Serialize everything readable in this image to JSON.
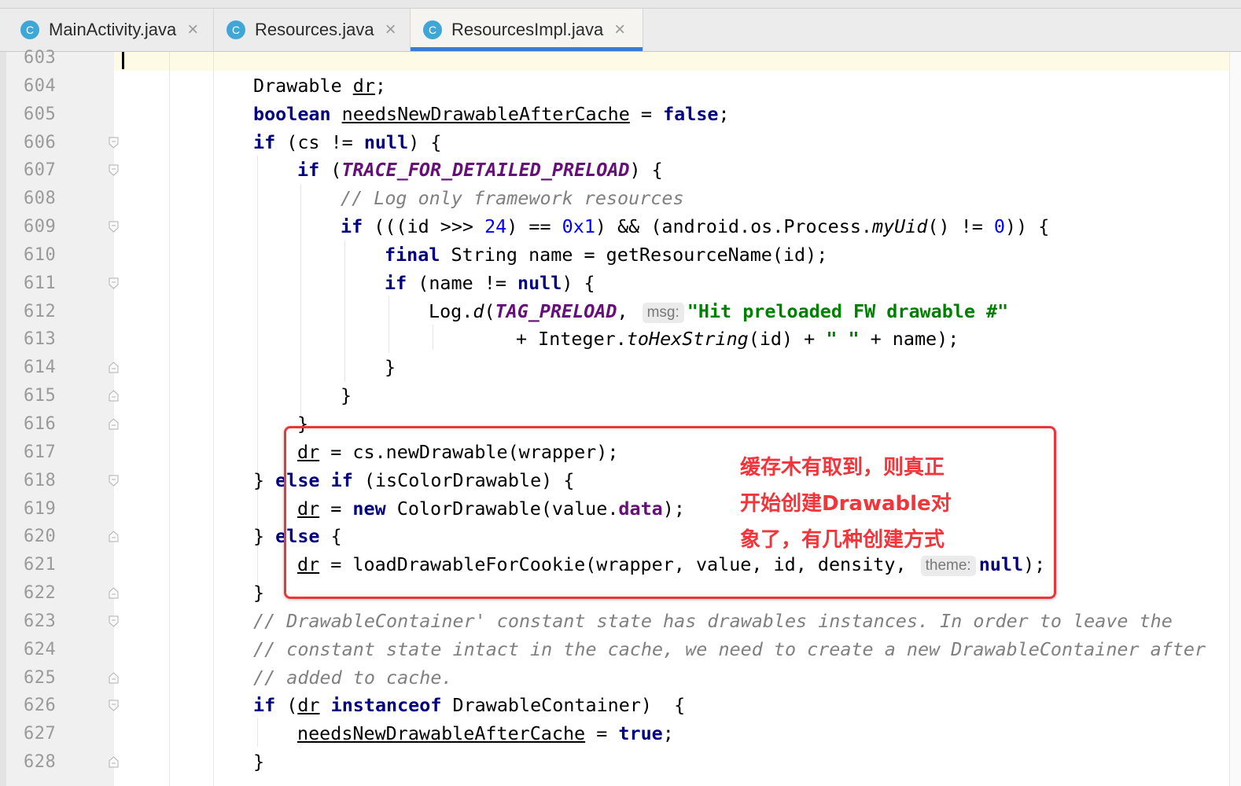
{
  "tabs": [
    {
      "label": "MainActivity.java",
      "icon": "C",
      "active": false
    },
    {
      "label": "Resources.java",
      "icon": "C",
      "active": false
    },
    {
      "label": "ResourcesImpl.java",
      "icon": "C",
      "active": true
    }
  ],
  "line_numbers": [
    "603",
    "604",
    "605",
    "606",
    "607",
    "608",
    "609",
    "610",
    "611",
    "612",
    "613",
    "614",
    "615",
    "616",
    "617",
    "618",
    "619",
    "620",
    "621",
    "622",
    "623",
    "624",
    "625",
    "626",
    "627",
    "628"
  ],
  "code": {
    "l604_type": "Drawable ",
    "l604_var": "dr",
    "l604_end": ";",
    "l605_kw": "boolean",
    "l605_var": "needsNewDrawableAfterCache",
    "l605_op": " = ",
    "l605_val": "false",
    "l605_end": ";",
    "l606_kw": "if",
    "l606_mid": " (cs != ",
    "l606_null": "null",
    "l606_end": ") {",
    "l607_kw": "if",
    "l607_open": " (",
    "l607_field": "TRACE_FOR_DETAILED_PRELOAD",
    "l607_end": ") {",
    "l608_comment": "// Log only framework resources",
    "l609_kw": "if",
    "l609_a": " (((id >>> ",
    "l609_n1": "24",
    "l609_b": ") == ",
    "l609_n2": "0x1",
    "l609_c": ") && (android.os.Process.",
    "l609_m": "myUid",
    "l609_d": "() != ",
    "l609_n3": "0",
    "l609_e": ")) {",
    "l610_kw": "final",
    "l610_rest": " String name = getResourceName(id);",
    "l611_kw": "if",
    "l611_mid": " (name != ",
    "l611_null": "null",
    "l611_end": ") {",
    "l612_a": "Log.",
    "l612_m": "d",
    "l612_b": "(",
    "l612_field": "TAG_PRELOAD",
    "l612_c": ", ",
    "l612_hint": "msg:",
    "l612_str": "\"Hit preloaded FW drawable #\"",
    "l613_a": "+ Integer.",
    "l613_m": "toHexString",
    "l613_b": "(id) + ",
    "l613_str": "\" \"",
    "l613_c": " + name);",
    "l614": "}",
    "l615": "}",
    "l616": "}",
    "l617_var": "dr",
    "l617_rest": " = cs.newDrawable(wrapper);",
    "l618_a": "} ",
    "l618_kw1": "else",
    "l618_sp": " ",
    "l618_kw2": "if",
    "l618_rest": " (isColorDrawable) {",
    "l619_var": "dr",
    "l619_a": " = ",
    "l619_kw": "new",
    "l619_b": " ColorDrawable(value.",
    "l619_field": "data",
    "l619_c": ");",
    "l620_a": "} ",
    "l620_kw": "else",
    "l620_b": " {",
    "l621_var": "dr",
    "l621_rest": " = loadDrawableForCookie(wrapper, value, id, density, ",
    "l621_hint": "theme:",
    "l621_null": "null",
    "l621_end": ");",
    "l622": "}",
    "l623_comment": "// DrawableContainer' constant state has drawables instances. In order to leave the",
    "l624_comment": "// constant state intact in the cache, we need to create a new DrawableContainer after",
    "l625_comment": "// added to cache.",
    "l626_kw1": "if",
    "l626_a": " (",
    "l626_var": "dr",
    "l626_sp": " ",
    "l626_kw2": "instanceof",
    "l626_b": " DrawableContainer)  {",
    "l627_var": "needsNewDrawableAfterCache",
    "l627_a": " = ",
    "l627_val": "true",
    "l627_end": ";",
    "l628": "}"
  },
  "annotation": {
    "lines": [
      "缓存木有取到，则真正",
      "开始创建Drawable对",
      "象了，有几种创建方式"
    ],
    "color": "#f2353b"
  },
  "colors": {
    "keyword": "#000080",
    "field": "#660e7a",
    "comment": "#808080",
    "number": "#0000ff",
    "string": "#008000",
    "tab_underline": "#3a7bd5"
  }
}
